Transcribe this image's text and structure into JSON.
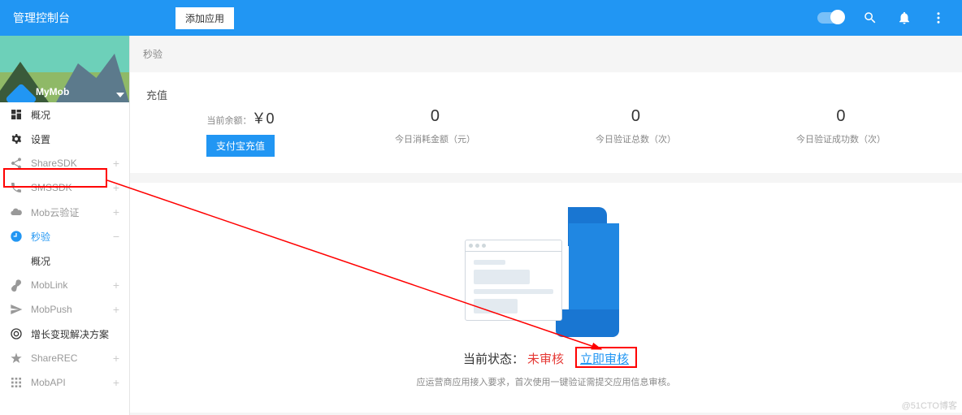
{
  "header": {
    "title": "管理控制台",
    "add_app": "添加应用"
  },
  "brand": {
    "name": "MyMob"
  },
  "menu": {
    "overview": "概况",
    "settings": "设置",
    "sharesdk": "ShareSDK",
    "smssdk": "SMSSDK",
    "mobcloud": "Mob云验证",
    "secverify": "秒验",
    "secverify_sub": "概况",
    "moblink": "MobLink",
    "mobpush": "MobPush",
    "growth": "增长变现解决方案",
    "sharerec": "ShareREC",
    "mobapi": "MobAPI"
  },
  "crumb": "秒验",
  "recharge": {
    "title": "充值",
    "balance_label": "当前余额：",
    "balance_value": "￥0",
    "alipay_btn": "支付宝充值"
  },
  "stats": [
    {
      "value": "0",
      "label": "今日消耗金额（元）"
    },
    {
      "value": "0",
      "label": "今日验证总数（次）"
    },
    {
      "value": "0",
      "label": "今日验证成功数（次）"
    }
  ],
  "empty": {
    "status_prefix": "当前状态：",
    "status_value": "未审核",
    "action": "立即审核",
    "note": "应运营商应用接入要求，首次使用一键验证需提交应用信息审核。"
  },
  "watermark": "@51CTO博客"
}
